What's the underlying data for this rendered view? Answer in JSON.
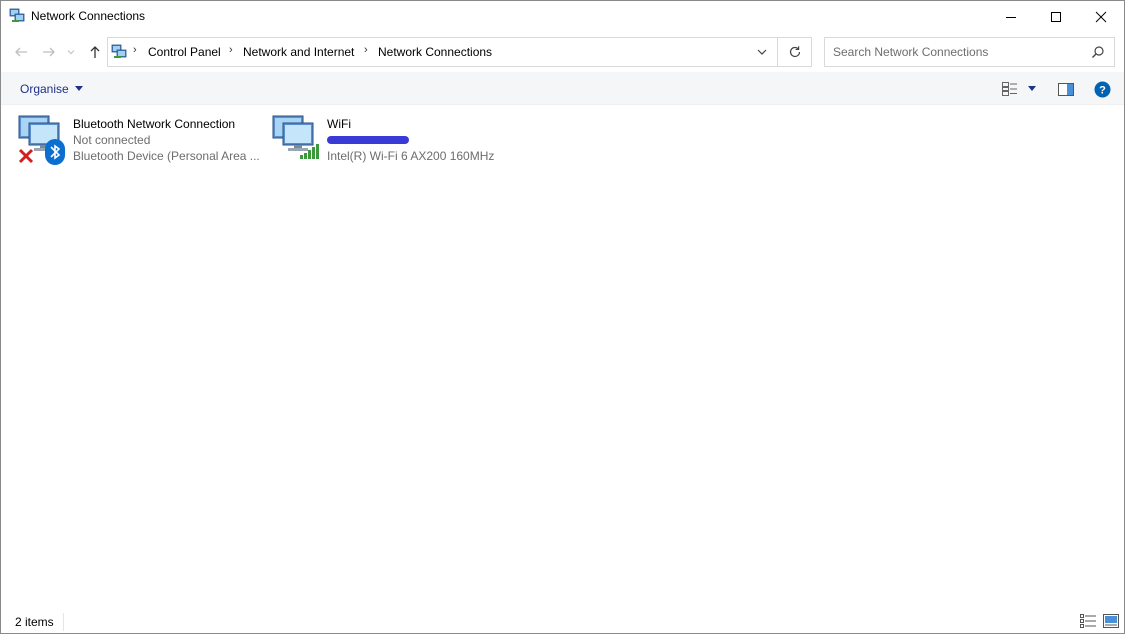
{
  "window": {
    "title": "Network Connections",
    "minimize_icon": "minimize-icon",
    "maximize_icon": "maximize-icon",
    "close_icon": "close-icon"
  },
  "nav": {
    "back_icon": "arrow-left-icon",
    "forward_icon": "arrow-right-icon",
    "recent_icon": "chevron-down-icon",
    "up_icon": "arrow-up-icon",
    "breadcrumbs": [
      "Control Panel",
      "Network and Internet",
      "Network Connections"
    ],
    "search_placeholder": "Search Network Connections",
    "search_value": ""
  },
  "toolbar": {
    "organise_label": "Organise",
    "icons": [
      "change-view-icon",
      "chevron-down-icon",
      "preview-pane-icon",
      "help-icon"
    ]
  },
  "connections": [
    {
      "name": "Bluetooth Network Connection",
      "status": "Not connected",
      "device": "Bluetooth Device (Personal Area ...",
      "icon": "network-computers-icon",
      "badge": "disconnected-x-icon",
      "overlay": "bluetooth-icon"
    },
    {
      "name": "WiFi",
      "status": "",
      "device": "Intel(R) Wi-Fi 6 AX200 160MHz",
      "icon": "network-computers-icon",
      "overlay": "wifi-signal-icon"
    }
  ],
  "statusbar": {
    "item_count": "2 items"
  },
  "colors": {
    "accent": "#1e3287",
    "help": "#0063b1",
    "redaction": "#3a3ad6"
  }
}
